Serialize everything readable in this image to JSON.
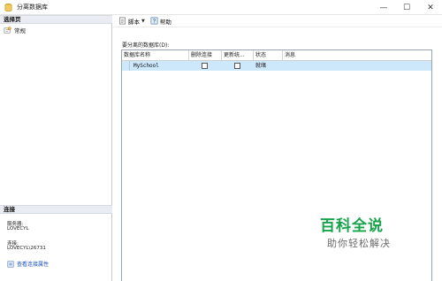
{
  "window": {
    "title": "分离数据库",
    "controls": {
      "minimize": "—",
      "maximize": "☐",
      "close": "✕"
    }
  },
  "sidebar": {
    "pages_header": "选择页",
    "pages": [
      {
        "label": "常规"
      }
    ],
    "connection_header": "连接",
    "server_label": "服务器:",
    "server_value": "LOVECYL",
    "connection_label": "连接:",
    "connection_value": "LOVECYL\\26731",
    "view_properties_link": "查看连接属性"
  },
  "toolbar": {
    "script_label": "脚本",
    "script_caret": "▼",
    "help_label": "帮助"
  },
  "main": {
    "grid_caption": "要分离的数据库(D):",
    "columns": [
      "数据库名称",
      "删除连接",
      "更新统...",
      "状态",
      "消息"
    ],
    "rows": [
      {
        "name": "MySchool",
        "drop_connections": false,
        "update_stats": false,
        "status": "就绪",
        "message": ""
      }
    ]
  },
  "watermark": {
    "title": "百科全说",
    "subtitle": "助你轻松解决"
  },
  "colors": {
    "selected_row": "#cde8fb",
    "link": "#1a4fb5",
    "watermark_green": "#17a34a"
  }
}
